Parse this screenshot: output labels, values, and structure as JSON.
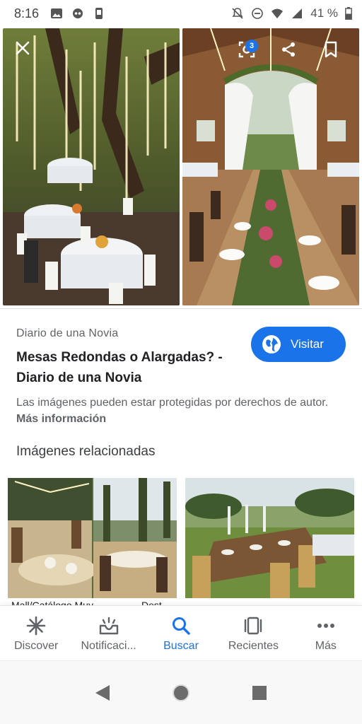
{
  "status_bar": {
    "time": "8:16",
    "battery_percent": "41 %"
  },
  "source": {
    "site_name": "Diario de una Novia",
    "title": "Mesas Redondas o Alargadas? - Diario de una Novia",
    "visit_label": "Visitar"
  },
  "copyright": {
    "text": "Las imágenes pueden estar protegidas por derechos de autor.",
    "link": "Más información"
  },
  "related": {
    "heading": "Imágenes relacionadas",
    "captions": [
      "Mall/Catálogo Muy...",
      "Dest..."
    ]
  },
  "lens": {
    "badge_count": "3"
  },
  "bottom_nav": [
    {
      "label": "Discover",
      "icon": "asterisk-icon",
      "active": false
    },
    {
      "label": "Notificaci...",
      "icon": "notification-tray-icon",
      "active": false
    },
    {
      "label": "Buscar",
      "icon": "search-icon",
      "active": true
    },
    {
      "label": "Recientes",
      "icon": "recents-icon",
      "active": false
    },
    {
      "label": "Más",
      "icon": "more-icon",
      "active": false
    }
  ],
  "colors": {
    "accent": "#1a73e8",
    "text_primary": "#202124",
    "text_secondary": "#5f6368"
  }
}
